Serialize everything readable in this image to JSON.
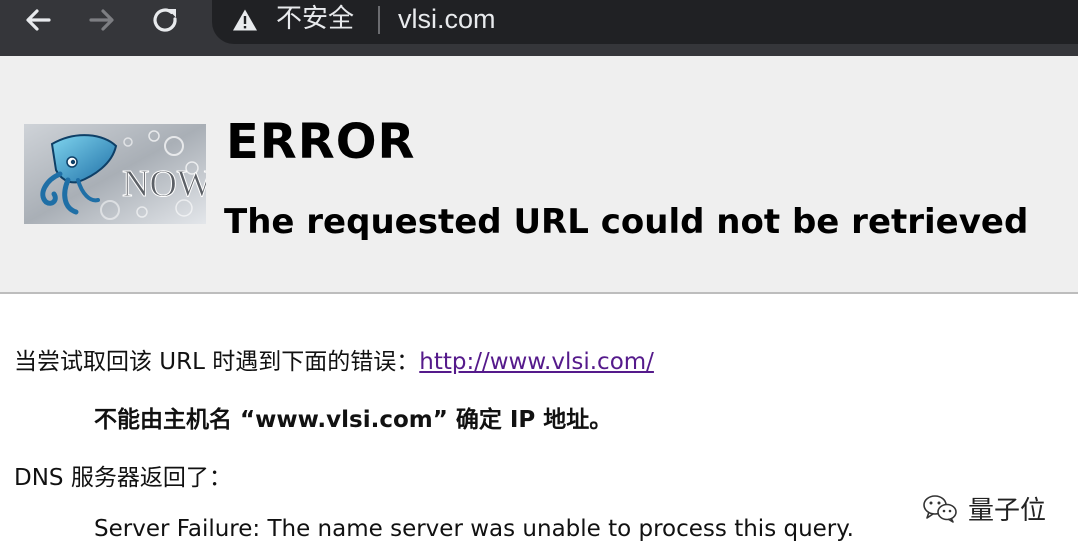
{
  "browser": {
    "security_label": "不安全",
    "url": "vlsi.com",
    "icons": {
      "back": "arrow-left-icon",
      "forward": "arrow-right-icon",
      "reload": "reload-icon",
      "security": "warning-triangle-icon"
    }
  },
  "page": {
    "logo_text": "NOW",
    "title": "ERROR",
    "subtitle": "The requested URL could not be retrieved",
    "intro_prefix": "当尝试取回该 URL 时遇到下面的错误：",
    "intro_link": "http://www.vlsi.com/",
    "dns_error": "不能由主机名 “www.vlsi.com” 确定 IP 地址。",
    "dns_returned": "DNS 服务器返回了：",
    "server_failure": "Server Failure: The name server was unable to process this query."
  },
  "watermark": {
    "text": "量子位",
    "icon": "wechat-icon"
  },
  "colors": {
    "toolbar_bg": "#35363a",
    "omnibox_bg": "#202124",
    "title_bg": "#efefef",
    "link": "#551a8b"
  }
}
